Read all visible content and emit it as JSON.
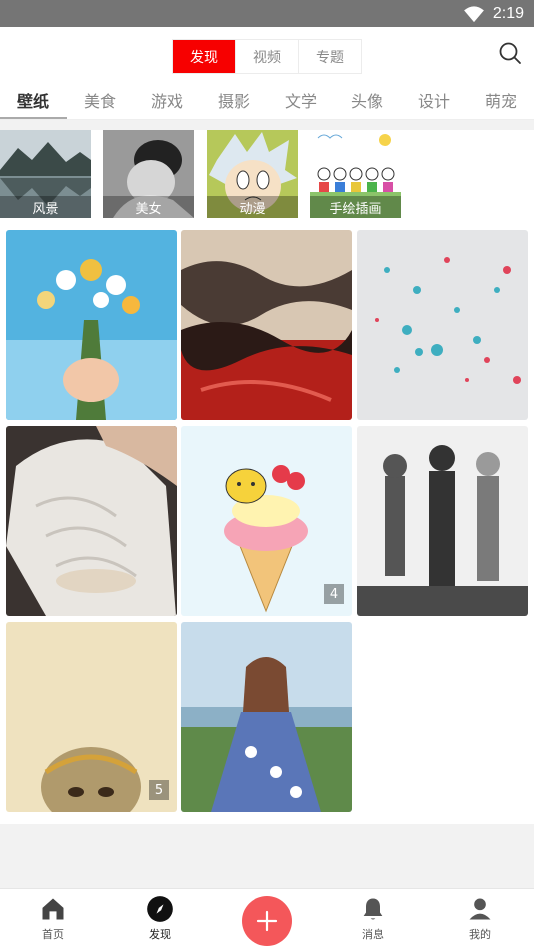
{
  "status_bar": {
    "time": "2:19"
  },
  "header": {
    "tabs": [
      {
        "label": "发现",
        "active": true
      },
      {
        "label": "视频"
      },
      {
        "label": "专题"
      }
    ]
  },
  "categories": [
    "壁纸",
    "美食",
    "游戏",
    "摄影",
    "文学",
    "头像",
    "设计",
    "萌宠"
  ],
  "active_category": "壁纸",
  "tiles": [
    {
      "label": "风景",
      "icon": "lake-mountain-image"
    },
    {
      "label": "美女",
      "icon": "portrait-image"
    },
    {
      "label": "动漫",
      "icon": "anime-image"
    },
    {
      "label": "手绘插画",
      "icon": "doodle-image"
    }
  ],
  "grid_badges": {
    "ice_cream": "4",
    "monkey": "5"
  },
  "bottom_nav": [
    {
      "label": "首页",
      "icon": "home-icon"
    },
    {
      "label": "发现",
      "icon": "compass-icon",
      "active": true
    },
    {
      "label": "",
      "icon": "plus-icon"
    },
    {
      "label": "消息",
      "icon": "bell-icon"
    },
    {
      "label": "我的",
      "icon": "person-icon"
    }
  ],
  "colors": {
    "accent": "#f70000",
    "fab": "#f4575a",
    "status_bar": "#757575"
  }
}
